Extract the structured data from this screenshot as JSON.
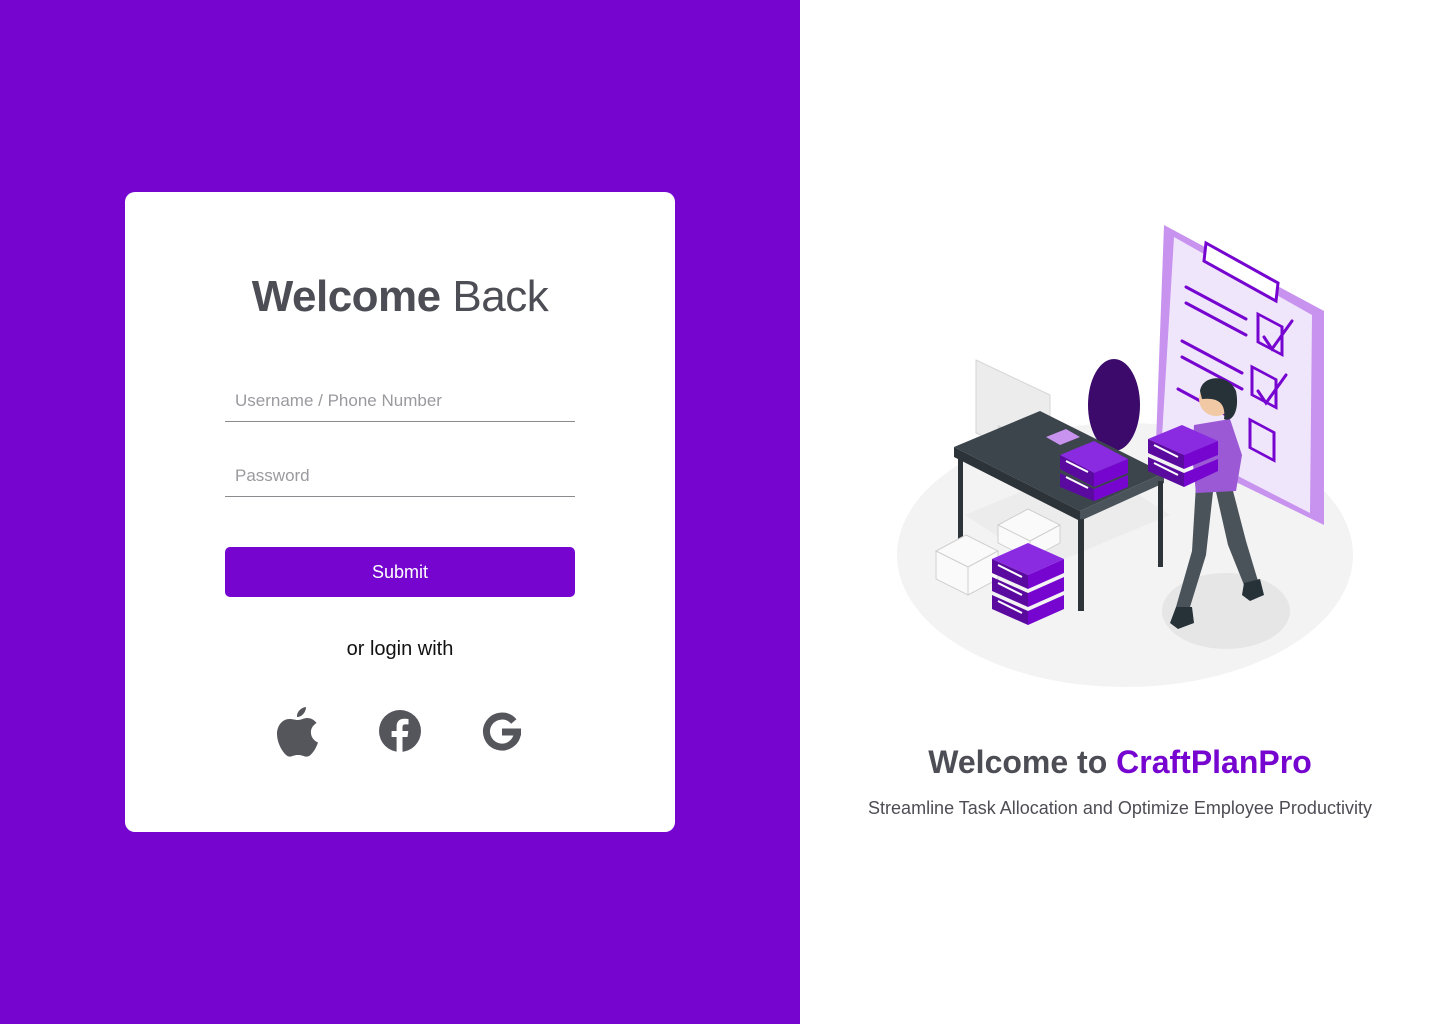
{
  "login": {
    "title_bold": "Welcome",
    "title_light": "Back",
    "username_placeholder": "Username / Phone Number",
    "password_placeholder": "Password",
    "submit_label": "Submit",
    "alt_login_text": "or login with",
    "social": [
      {
        "icon": "apple-icon"
      },
      {
        "icon": "facebook-icon"
      },
      {
        "icon": "google-icon"
      }
    ]
  },
  "promo": {
    "heading_prefix": "Welcome to",
    "brand": "CraftPlanPro",
    "tagline": "Streamline Task Allocation and Optimize Employee Productivity"
  },
  "colors": {
    "brand_purple": "#7605d0",
    "text_gray": "#4d4d55",
    "icon_gray": "#55555c"
  }
}
